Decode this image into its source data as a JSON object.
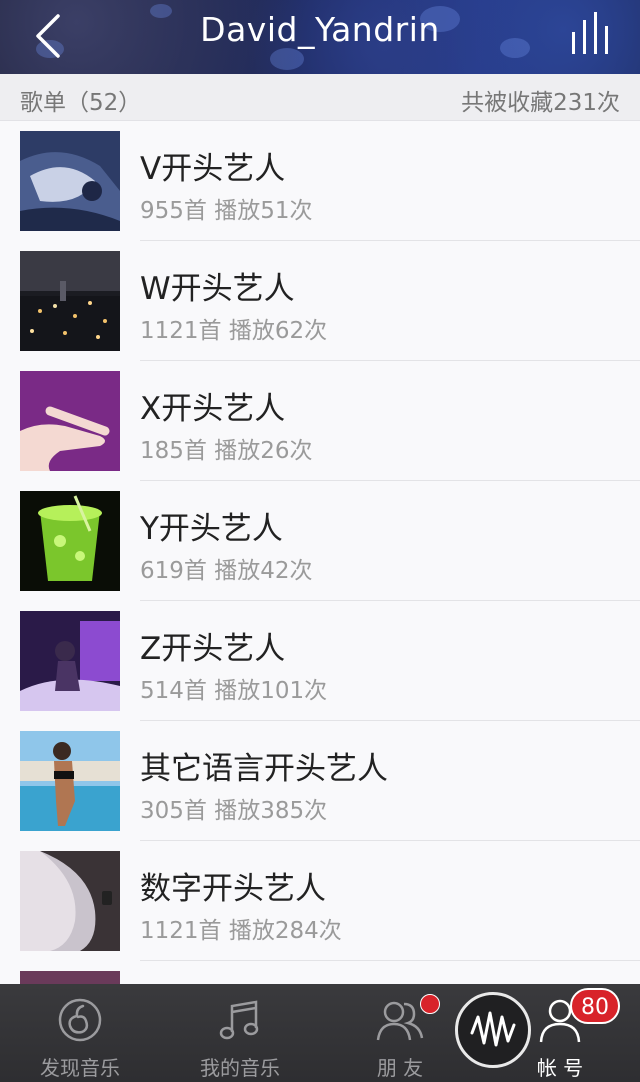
{
  "header": {
    "title": "David_Yandrin",
    "back_icon": "chevron-left-icon",
    "nowplaying_icon": "equalizer-bars-icon"
  },
  "section": {
    "playlist_count": "歌单（52）",
    "collected_total": "共被收藏231次"
  },
  "playlists": [
    {
      "title": "V开头艺人",
      "stats": "955首 播放51次",
      "cover": "anime-figure-dark-blue"
    },
    {
      "title": "W开头艺人",
      "stats": "1121首 播放62次",
      "cover": "city-night-skyline"
    },
    {
      "title": "X开头艺人",
      "stats": "185首 播放26次",
      "cover": "hand-purple-background"
    },
    {
      "title": "Y开头艺人",
      "stats": "619首 播放42次",
      "cover": "green-cocktail-glass"
    },
    {
      "title": "Z开头艺人",
      "stats": "514首 播放101次",
      "cover": "purple-lit-room"
    },
    {
      "title": "其它语言开头艺人",
      "stats": "305首 播放385次",
      "cover": "woman-at-pool"
    },
    {
      "title": "数字开头艺人",
      "stats": "1121首 播放284次",
      "cover": "silhouette-with-watch"
    }
  ],
  "tabbar": {
    "tabs": [
      {
        "label": "发现音乐",
        "icon": "netease-logo-icon"
      },
      {
        "label": "我的音乐",
        "icon": "music-note-icon"
      },
      {
        "label": "朋 友",
        "icon": "friends-icon"
      },
      {
        "label": "帐 号",
        "icon": "account-icon"
      }
    ],
    "account_badge": "80",
    "player_icon": "waveform-play-icon"
  },
  "colors": {
    "accent_red": "#d8232a",
    "tabbar_bg": "#2e2e31",
    "header_blue": "#23368a"
  }
}
